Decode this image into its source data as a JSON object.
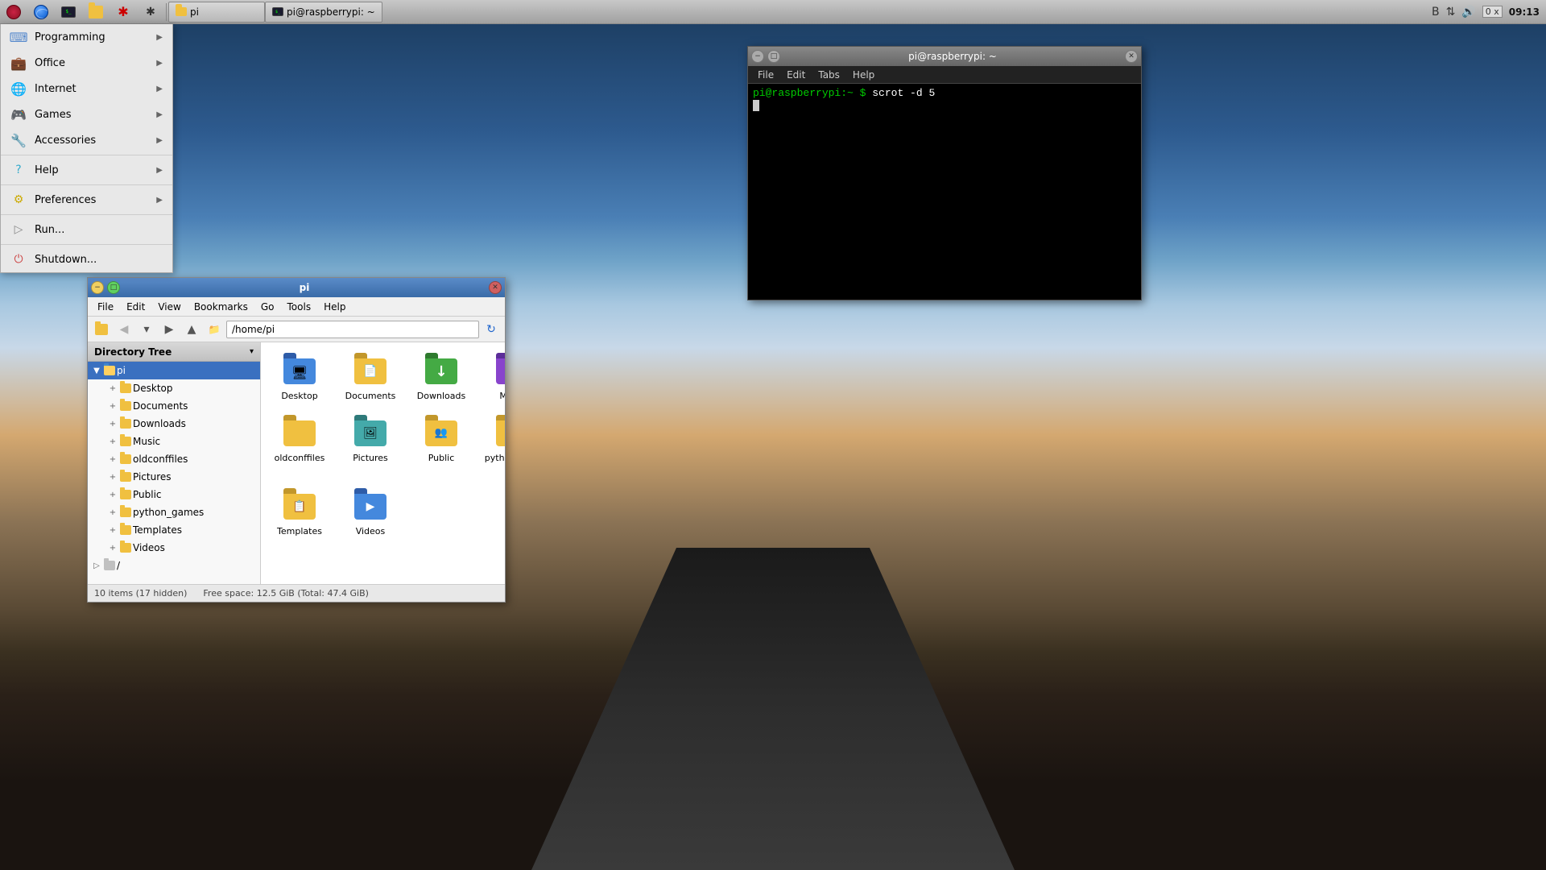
{
  "taskbar": {
    "buttons": [
      {
        "name": "raspberry-btn",
        "icon": "raspberry"
      },
      {
        "name": "globe-btn",
        "icon": "globe"
      },
      {
        "name": "terminal-btn",
        "icon": "terminal-prompt"
      },
      {
        "name": "folder-btn",
        "icon": "folder"
      },
      {
        "name": "asterisk1-btn",
        "icon": "asterisk-red"
      },
      {
        "name": "asterisk2-btn",
        "icon": "asterisk-dark"
      }
    ],
    "windows": [
      {
        "id": "window-pi-folder",
        "label": "pi",
        "active": false,
        "icon": "folder"
      },
      {
        "id": "window-pi-terminal",
        "label": "pi@raspberrypi: ~",
        "active": false,
        "icon": "terminal-prompt"
      }
    ],
    "tray": {
      "bluetooth": "B",
      "arrows": "⇅",
      "volume": "🔊",
      "mute_label": "0 x",
      "time": "09:13"
    }
  },
  "app_menu": {
    "visible": true,
    "items": [
      {
        "label": "Programming",
        "icon": "code",
        "arrow": true
      },
      {
        "label": "Office",
        "icon": "briefcase",
        "arrow": true
      },
      {
        "label": "Internet",
        "icon": "globe",
        "arrow": true
      },
      {
        "label": "Games",
        "icon": "gamepad",
        "arrow": true
      },
      {
        "label": "Accessories",
        "icon": "toolbox",
        "arrow": true
      },
      {
        "separator": true
      },
      {
        "label": "Help",
        "icon": "help",
        "arrow": true
      },
      {
        "separator": true
      },
      {
        "label": "Preferences",
        "icon": "preferences",
        "arrow": true
      },
      {
        "separator": true
      },
      {
        "label": "Run...",
        "icon": "run",
        "arrow": false
      },
      {
        "separator": true
      },
      {
        "label": "Shutdown...",
        "icon": "shutdown",
        "arrow": false
      }
    ]
  },
  "file_manager": {
    "title": "pi",
    "menubar": [
      "File",
      "Edit",
      "View",
      "Bookmarks",
      "Go",
      "Tools",
      "Help"
    ],
    "address": "/home/pi",
    "sidebar_title": "Directory Tree",
    "tree": [
      {
        "label": "pi",
        "level": 0,
        "selected": true,
        "icon": "folder-blue",
        "expand": true
      },
      {
        "label": "Desktop",
        "level": 1,
        "expand": true
      },
      {
        "label": "Documents",
        "level": 1,
        "expand": true
      },
      {
        "label": "Downloads",
        "level": 1,
        "expand": true
      },
      {
        "label": "Music",
        "level": 1,
        "expand": true
      },
      {
        "label": "oldconffiles",
        "level": 1,
        "expand": true
      },
      {
        "label": "Pictures",
        "level": 1,
        "expand": true
      },
      {
        "label": "Public",
        "level": 1,
        "expand": true
      },
      {
        "label": "python_games",
        "level": 1,
        "expand": true
      },
      {
        "label": "Templates",
        "level": 1,
        "expand": true
      },
      {
        "label": "Videos",
        "level": 1,
        "expand": true
      },
      {
        "label": "/",
        "level": 0,
        "expand": false
      }
    ],
    "files": [
      {
        "name": "Desktop",
        "icon": "desktop"
      },
      {
        "name": "Documents",
        "icon": "documents"
      },
      {
        "name": "Downloads",
        "icon": "downloads"
      },
      {
        "name": "Music",
        "icon": "music"
      },
      {
        "name": "oldconffiles",
        "icon": "oldconf"
      },
      {
        "name": "Pictures",
        "icon": "pictures"
      },
      {
        "name": "Public",
        "icon": "public"
      },
      {
        "name": "python_games",
        "icon": "python"
      },
      {
        "name": "Templates",
        "icon": "templates"
      },
      {
        "name": "Videos",
        "icon": "videos"
      }
    ],
    "statusbar": {
      "items_count": "10 items (17 hidden)",
      "free_space": "Free space: 12.5 GiB (Total: 47.4 GiB)"
    }
  },
  "terminal": {
    "title": "pi@raspberrypi: ~",
    "menubar": [
      "File",
      "Edit",
      "Tabs",
      "Help"
    ],
    "prompt": "pi@raspberrypi:~",
    "command": "scrot -d 5",
    "cursor": true
  }
}
